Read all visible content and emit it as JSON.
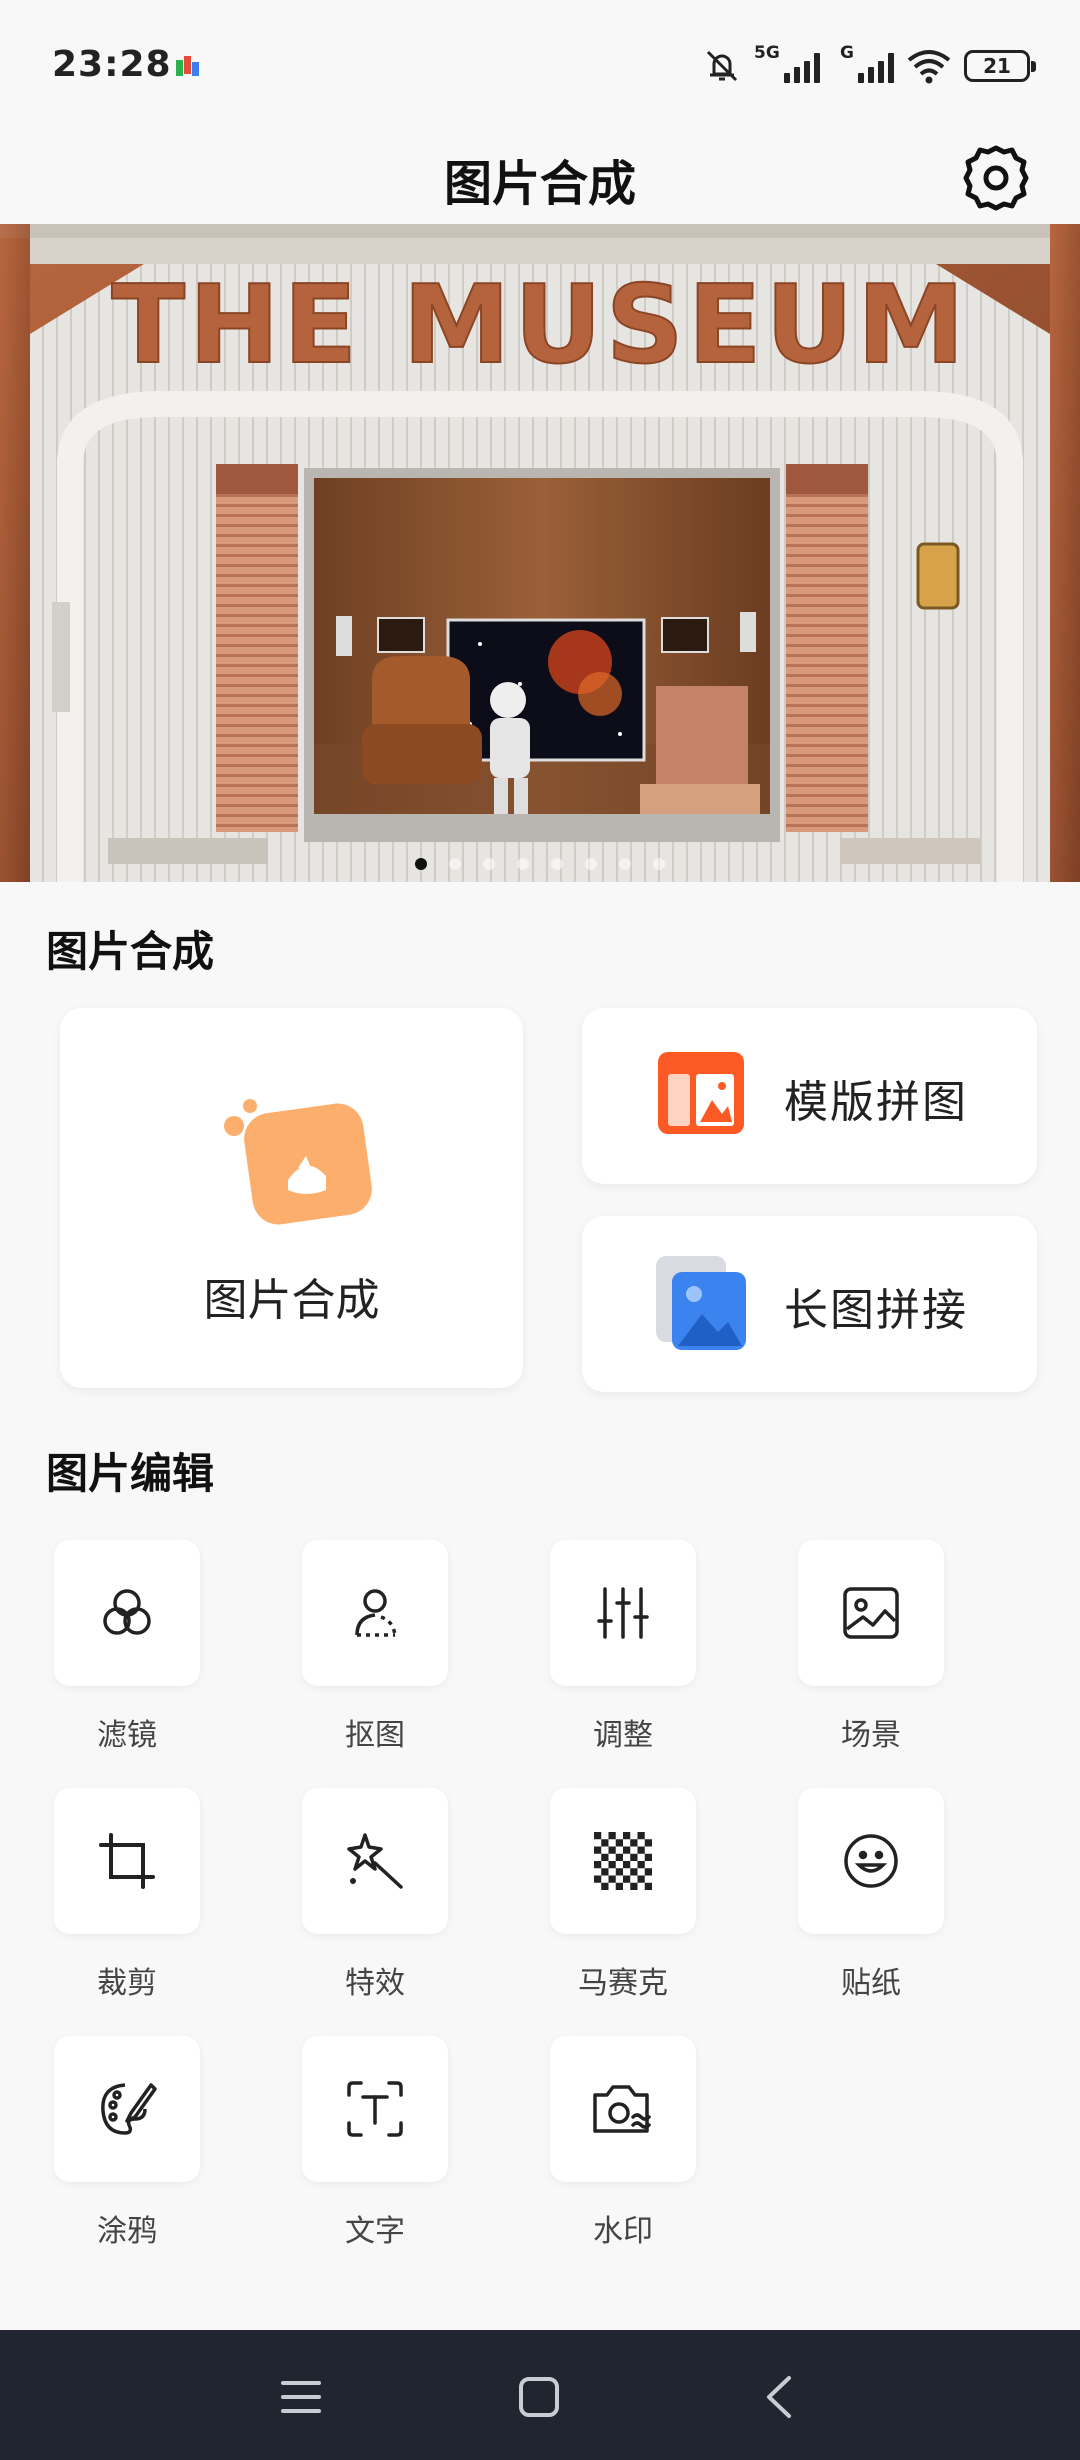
{
  "status": {
    "time": "23:28",
    "network_5g": "5G",
    "network_g": "G",
    "battery": "21"
  },
  "header": {
    "title": "图片合成"
  },
  "banner": {
    "sign_text": "THE MUSEUM",
    "dot_count": 8,
    "active_dot": 0
  },
  "compose": {
    "title": "图片合成",
    "main_card": "图片合成",
    "template_card": "模版拼图",
    "long_card": "长图拼接"
  },
  "edit": {
    "title": "图片编辑",
    "tools": [
      {
        "label": "滤镜",
        "icon": "filter-icon"
      },
      {
        "label": "抠图",
        "icon": "cutout-icon"
      },
      {
        "label": "调整",
        "icon": "adjust-icon"
      },
      {
        "label": "场景",
        "icon": "scene-icon"
      },
      {
        "label": "裁剪",
        "icon": "crop-icon"
      },
      {
        "label": "特效",
        "icon": "magic-wand-icon"
      },
      {
        "label": "马赛克",
        "icon": "mosaic-icon"
      },
      {
        "label": "贴纸",
        "icon": "sticker-icon"
      },
      {
        "label": "涂鸦",
        "icon": "palette-icon"
      },
      {
        "label": "文字",
        "icon": "text-icon"
      },
      {
        "label": "水印",
        "icon": "watermark-camera-icon"
      }
    ]
  },
  "colors": {
    "accent_orange": "#fd7e2b",
    "peach": "#fcae6c",
    "blue": "#3b84f0",
    "nav_bg": "#212530"
  }
}
